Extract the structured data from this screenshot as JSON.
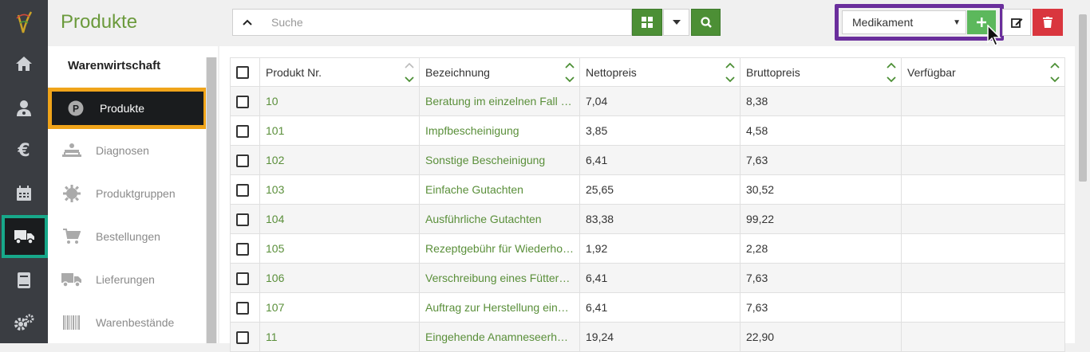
{
  "header": {
    "page_title": "Produkte",
    "search_placeholder": "Suche",
    "type_select": {
      "selected": "Medikament"
    },
    "colors": {
      "brand_green": "#6b9a3c",
      "action_green": "#4c8f35",
      "add_green": "#5cb85c",
      "delete_red": "#d9363e",
      "highlight_purple": "#6a2e9c",
      "highlight_orange": "#f0a41a",
      "highlight_teal": "#17a88a"
    }
  },
  "rail": {
    "items": [
      {
        "name": "home-icon"
      },
      {
        "name": "patients-icon"
      },
      {
        "name": "euro-icon"
      },
      {
        "name": "calendar-icon"
      },
      {
        "name": "truck-icon",
        "active": true
      },
      {
        "name": "book-icon"
      },
      {
        "name": "settings-icon"
      }
    ]
  },
  "subnav": {
    "heading": "Warenwirtschaft",
    "items": [
      {
        "label": "Produkte",
        "icon": "product-icon",
        "active": true
      },
      {
        "label": "Diagnosen",
        "icon": "diagnosis-icon"
      },
      {
        "label": "Produktgruppen",
        "icon": "gear-icon"
      },
      {
        "label": "Bestellungen",
        "icon": "cart-icon"
      },
      {
        "label": "Lieferungen",
        "icon": "truck-icon"
      },
      {
        "label": "Warenbestände",
        "icon": "barcode-icon"
      }
    ]
  },
  "table": {
    "columns": [
      "Produkt Nr.",
      "Bezeichnung",
      "Nettopreis",
      "Bruttopreis",
      "Verfügbar"
    ],
    "rows": [
      {
        "nr": "10",
        "bezeichnung": "Beratung im einzelnen Fall ohne Untersuchung",
        "netto": "7,04",
        "brutto": "8,38",
        "verfuegbar": ""
      },
      {
        "nr": "101",
        "bezeichnung": "Impfbescheinigung",
        "netto": "3,85",
        "brutto": "4,58",
        "verfuegbar": ""
      },
      {
        "nr": "102",
        "bezeichnung": "Sonstige Bescheinigung",
        "netto": "6,41",
        "brutto": "7,63",
        "verfuegbar": ""
      },
      {
        "nr": "103",
        "bezeichnung": "Einfache Gutachten",
        "netto": "25,65",
        "brutto": "30,52",
        "verfuegbar": ""
      },
      {
        "nr": "104",
        "bezeichnung": "Ausführliche Gutachten",
        "netto": "83,38",
        "brutto": "99,22",
        "verfuegbar": ""
      },
      {
        "nr": "105",
        "bezeichnung": "Rezeptgebühr für Wiederholungsrezept",
        "netto": "1,92",
        "brutto": "2,28",
        "verfuegbar": ""
      },
      {
        "nr": "106",
        "bezeichnung": "Verschreibung eines Fütterungsarzneimittels",
        "netto": "6,41",
        "brutto": "7,63",
        "verfuegbar": ""
      },
      {
        "nr": "107",
        "bezeichnung": "Auftrag zur Herstellung eines Arzneimittels",
        "netto": "6,41",
        "brutto": "7,63",
        "verfuegbar": ""
      },
      {
        "nr": "11",
        "bezeichnung": "Eingehende Anamneseerhebung",
        "netto": "19,24",
        "brutto": "22,90",
        "verfuegbar": ""
      }
    ]
  }
}
